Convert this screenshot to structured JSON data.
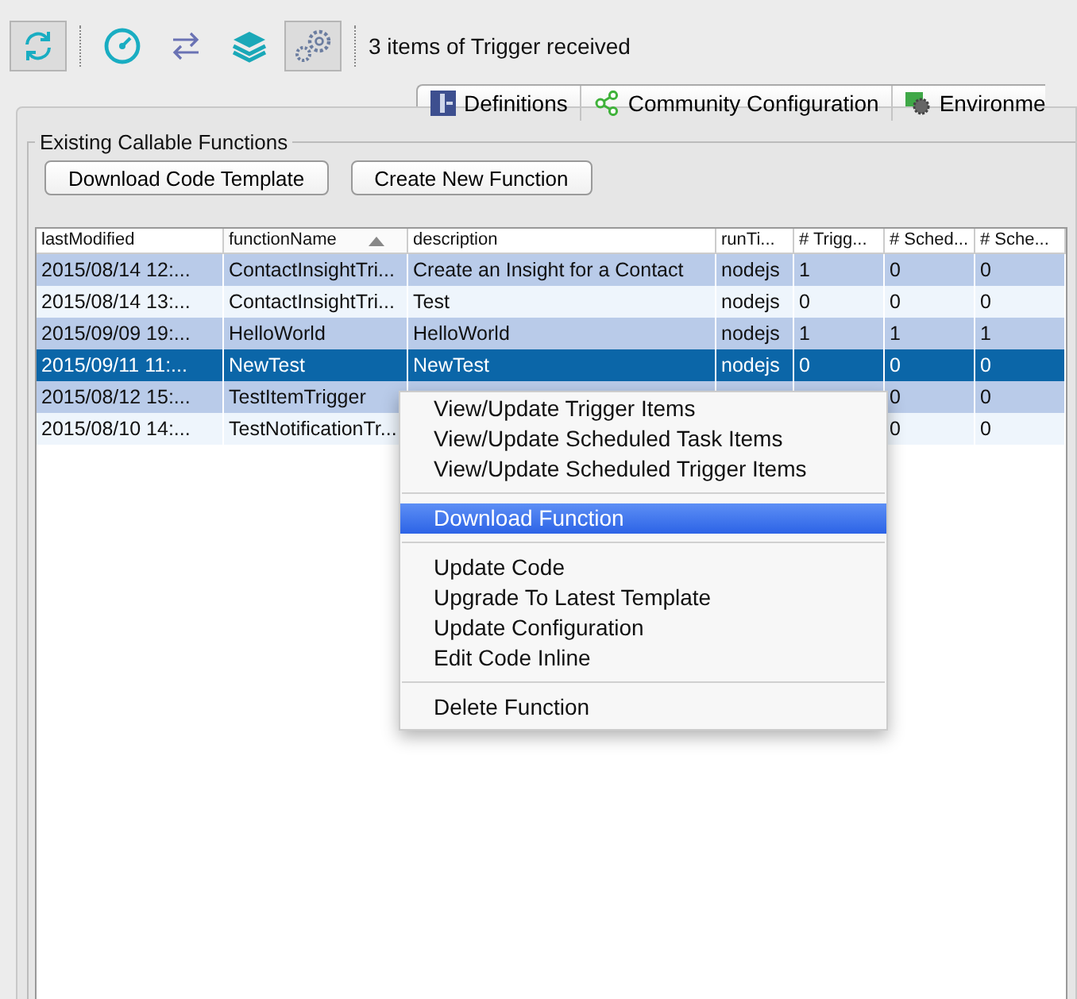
{
  "toolbar": {
    "buttons": [
      {
        "kind": "refresh",
        "pressed": true
      },
      {
        "kind": "gauge",
        "pressed": false
      },
      {
        "kind": "swap",
        "pressed": false
      },
      {
        "kind": "layers",
        "pressed": false
      },
      {
        "kind": "gears",
        "pressed": true
      }
    ],
    "status": "3 items of Trigger received"
  },
  "tabs": [
    {
      "kind": "definitions",
      "label": "Definitions"
    },
    {
      "kind": "community",
      "label": "Community Configuration"
    },
    {
      "kind": "environment",
      "label": "Environme"
    }
  ],
  "group": {
    "title": "Existing Callable Functions",
    "buttons": [
      "Download Code Template",
      "Create New Function"
    ]
  },
  "table": {
    "columns": [
      {
        "label": "lastModified",
        "sorted": false
      },
      {
        "label": "functionName",
        "sorted": true
      },
      {
        "label": "description",
        "sorted": false
      },
      {
        "label": "runTi...",
        "sorted": false
      },
      {
        "label": "# Trigg...",
        "sorted": false
      },
      {
        "label": "# Sched...",
        "sorted": false
      },
      {
        "label": "# Sche...",
        "sorted": false
      }
    ],
    "rows": [
      {
        "selected": false,
        "cells": [
          "2015/08/14 12:...",
          "ContactInsightTri...",
          "Create an Insight for a Contact",
          "nodejs",
          "1",
          "0",
          "0"
        ]
      },
      {
        "selected": false,
        "cells": [
          "2015/08/14 13:...",
          "ContactInsightTri...",
          "Test",
          "nodejs",
          "0",
          "0",
          "0"
        ]
      },
      {
        "selected": false,
        "cells": [
          "2015/09/09 19:...",
          "HelloWorld",
          "HelloWorld",
          "nodejs",
          "1",
          "1",
          "1"
        ]
      },
      {
        "selected": true,
        "cells": [
          "2015/09/11 11:...",
          "NewTest",
          "NewTest",
          "nodejs",
          "0",
          "0",
          "0"
        ]
      },
      {
        "selected": false,
        "cells": [
          "2015/08/12 15:...",
          "TestItemTrigger",
          null,
          null,
          null,
          "0",
          "0"
        ]
      },
      {
        "selected": false,
        "cells": [
          "2015/08/10 14:...",
          "TestNotificationTr...",
          null,
          null,
          null,
          "0",
          "0"
        ]
      }
    ]
  },
  "context_menu": {
    "items": [
      {
        "kind": "item",
        "label": "View/Update Trigger Items",
        "selected": false
      },
      {
        "kind": "item",
        "label": "View/Update Scheduled Task Items",
        "selected": false
      },
      {
        "kind": "item",
        "label": "View/Update Scheduled Trigger Items",
        "selected": false
      },
      {
        "kind": "separator"
      },
      {
        "kind": "item",
        "label": "Download Function",
        "selected": true
      },
      {
        "kind": "separator"
      },
      {
        "kind": "item",
        "label": "Update Code",
        "selected": false
      },
      {
        "kind": "item",
        "label": "Upgrade To Latest Template",
        "selected": false
      },
      {
        "kind": "item",
        "label": "Update Configuration",
        "selected": false
      },
      {
        "kind": "item",
        "label": "Edit Code Inline",
        "selected": false
      },
      {
        "kind": "separator"
      },
      {
        "kind": "item",
        "label": "Delete Function",
        "selected": false
      }
    ]
  }
}
